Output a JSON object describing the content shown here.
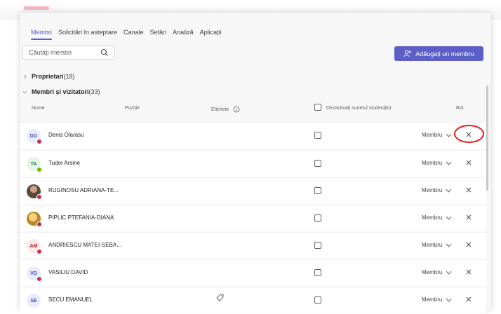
{
  "tabs": [
    {
      "label": "Membri",
      "active": true
    },
    {
      "label": "Solicitări în asteptare",
      "active": false
    },
    {
      "label": "Canale",
      "active": false
    },
    {
      "label": "Setări",
      "active": false
    },
    {
      "label": "Analiză",
      "active": false
    },
    {
      "label": "Aplicații",
      "active": false
    }
  ],
  "search": {
    "placeholder": "Căutați membri",
    "icon": "search-icon"
  },
  "add_member": {
    "label": "Adăugați un membru",
    "icon": "add-person-icon"
  },
  "owners": {
    "label": "Proprietari",
    "count": "(18)"
  },
  "members": {
    "label": "Membri și vizitatori",
    "count": "(33)"
  },
  "columns": {
    "name": "Nume",
    "position": "Poziție",
    "tags": "Etichete",
    "mute": "Dezactivați sunetul studenților",
    "role": "Rol"
  },
  "rows": [
    {
      "initials": "DO",
      "name": "Denis Olarasu",
      "role": "Membru",
      "avatar_bg": "#e8ebfa",
      "avatar_fg": "#4f52b2",
      "status": "#c4314b",
      "photo": false
    },
    {
      "initials": "TA",
      "name": "Tudor Arsine",
      "role": "Membru",
      "avatar_bg": "#e5f5e7",
      "avatar_fg": "#237b4b",
      "status": "#6bb700",
      "photo": false
    },
    {
      "initials": "",
      "name": "RUGINOSU ADRIANA-TE...",
      "role": "Membru",
      "avatar_bg": "#5a4a3a",
      "avatar_fg": "#ffffff",
      "status": "#c4314b",
      "photo": true
    },
    {
      "initials": "",
      "name": "PIPLIC PTEFANIA-DIANA",
      "role": "Membru",
      "avatar_bg": "#d8a83a",
      "avatar_fg": "#ffffff",
      "status": "#c4314b",
      "photo": true
    },
    {
      "initials": "AM",
      "name": "ANDRIESCU MATEI-SEBA...",
      "role": "Membru",
      "avatar_bg": "#fde7e9",
      "avatar_fg": "#a4262c",
      "status": "#c4314b",
      "photo": false
    },
    {
      "initials": "VD",
      "name": "VASILIU DAVID",
      "role": "Membru",
      "avatar_bg": "#e8ebfa",
      "avatar_fg": "#4f52b2",
      "status": "#c4314b",
      "photo": false
    },
    {
      "initials": "SE",
      "name": "SECU EMANUEL",
      "role": "Membru",
      "avatar_bg": "#e8ebfa",
      "avatar_fg": "#4f52b2",
      "status": "#c4314b",
      "photo": false
    }
  ],
  "colors": {
    "accent": "#5b5fc7",
    "highlight_ring": "#e0201c"
  }
}
